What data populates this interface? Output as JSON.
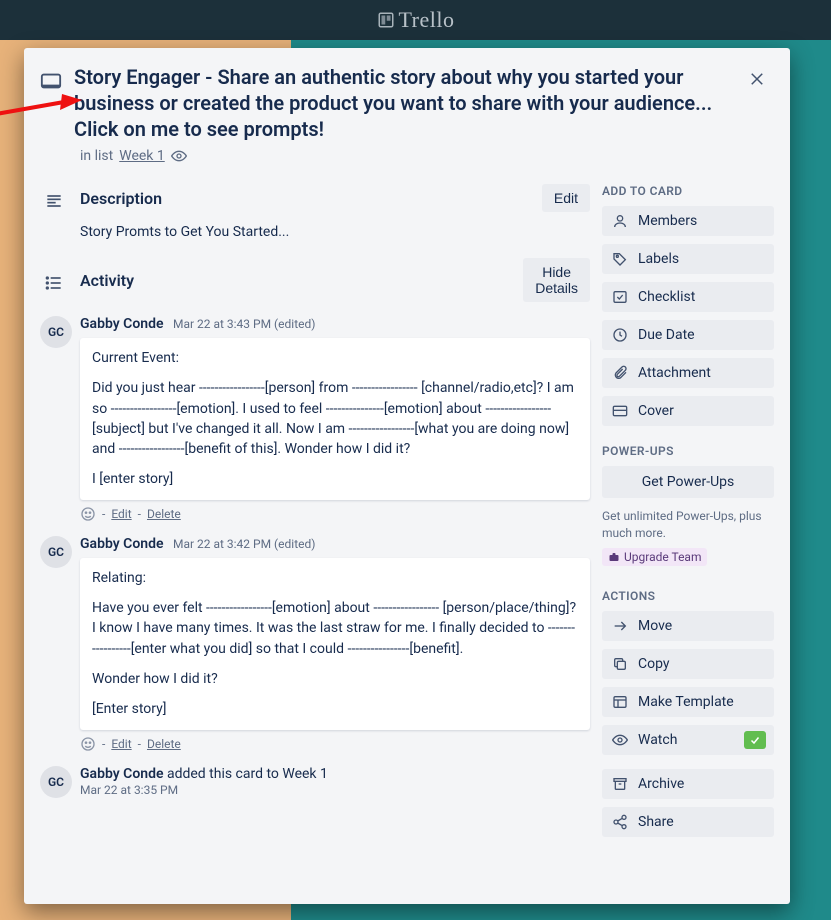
{
  "app": {
    "logo_text": "Trello"
  },
  "card": {
    "title": "Story Engager - Share an authentic story about why you started your business or created the product you want to share with your audience... Click on me to see prompts!",
    "in_list_prefix": "in list ",
    "list_name": "Week 1"
  },
  "description": {
    "heading": "Description",
    "edit_label": "Edit",
    "text": "Story Promts to Get You Started..."
  },
  "activity": {
    "heading": "Activity",
    "hide_details_label": "Hide Details",
    "edit_label": "Edit",
    "delete_label": "Delete",
    "items": [
      {
        "initials": "GC",
        "author": "Gabby Conde",
        "time": "Mar 22 at 3:43 PM (edited)",
        "p1": "Current Event:",
        "p2": "Did you just hear -----------------[person] from ----------------- [channel/radio,etc]? I am so -----------------[emotion]. I used to feel ---------------[emotion] about -----------------[subject] but I've changed it all. Now I am -----------------[what you are doing now] and -----------------[benefit of this]. Wonder how I did it?",
        "p3": "I [enter story]"
      },
      {
        "initials": "GC",
        "author": "Gabby Conde",
        "time": "Mar 22 at 3:42 PM (edited)",
        "p1": "Relating:",
        "p2": "Have you ever felt -----------------[emotion] about ----------------- [person/place/thing]? I know I have many times. It was the last straw for me. I finally decided to -----------------[enter what you did] so that I could ----------------[benefit].",
        "p3": "Wonder how I did it?",
        "p4": "[Enter story]"
      }
    ],
    "log": {
      "initials": "GC",
      "author": "Gabby Conde",
      "action": " added this card to Week 1",
      "time": "Mar 22 at 3:35 PM"
    }
  },
  "sidebar": {
    "add_heading": "Add to card",
    "add": [
      {
        "label": "Members"
      },
      {
        "label": "Labels"
      },
      {
        "label": "Checklist"
      },
      {
        "label": "Due Date"
      },
      {
        "label": "Attachment"
      },
      {
        "label": "Cover"
      }
    ],
    "powerups_heading": "Power-Ups",
    "get_powerups": "Get Power-Ups",
    "powerups_note": "Get unlimited Power-Ups, plus much more.",
    "upgrade_label": "Upgrade Team",
    "actions_heading": "Actions",
    "actions": [
      {
        "label": "Move"
      },
      {
        "label": "Copy"
      },
      {
        "label": "Make Template"
      },
      {
        "label": "Watch",
        "watched": true
      },
      {
        "label": "Archive"
      },
      {
        "label": "Share"
      }
    ]
  }
}
